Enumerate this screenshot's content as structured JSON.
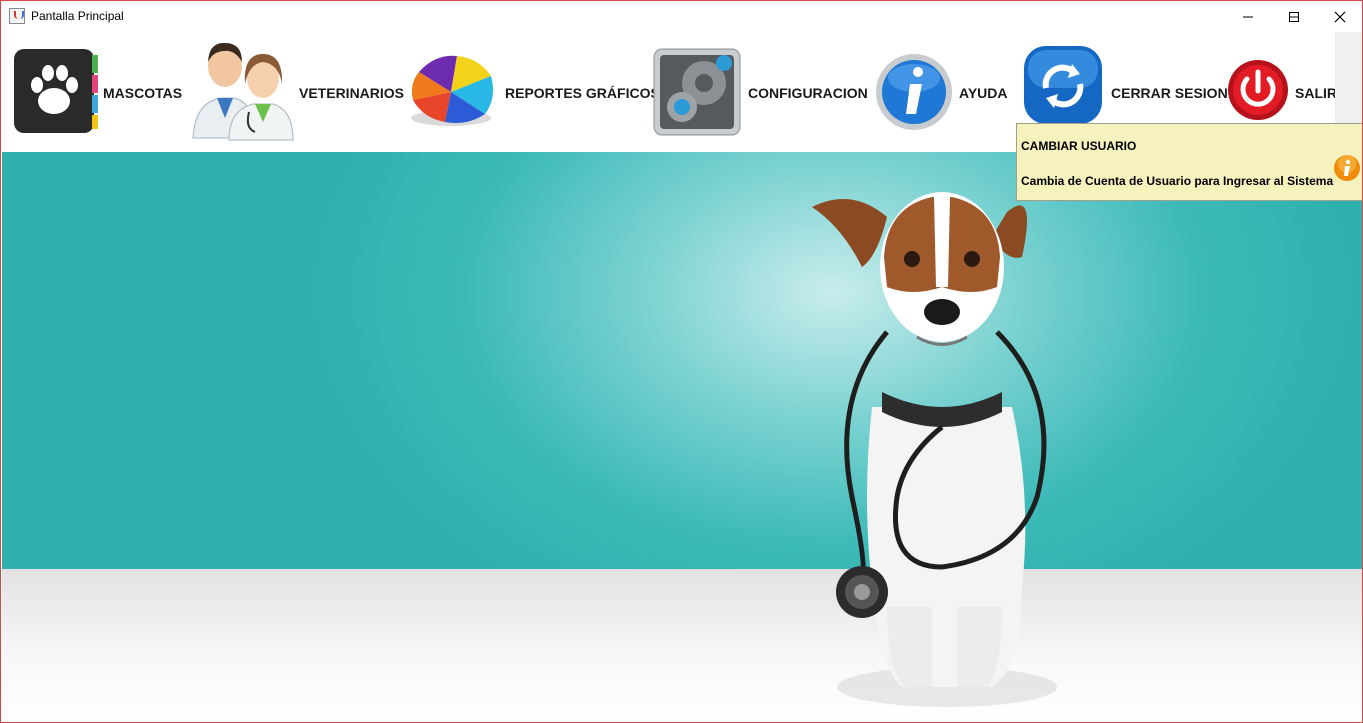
{
  "window": {
    "title": "Pantalla Principal",
    "controls": [
      "minimize",
      "maximize",
      "close"
    ]
  },
  "toolbar": {
    "items": [
      {
        "label": "MASCOTAS",
        "icon": "paw-book-icon"
      },
      {
        "label": "VETERINARIOS",
        "icon": "doctors-icon"
      },
      {
        "label": "REPORTES GRÁFICOS",
        "icon": "pie-chart-icon"
      },
      {
        "label": "CONFIGURACION",
        "icon": "gears-icon"
      },
      {
        "label": "AYUDA",
        "icon": "info-icon"
      },
      {
        "label": "CERRAR SESION",
        "icon": "refresh-icon"
      },
      {
        "label": "SALIR",
        "icon": "power-icon"
      }
    ]
  },
  "tooltip": {
    "title": "CAMBIAR USUARIO",
    "description": "Cambia de Cuenta de Usuario para Ingresar al Sistema",
    "icon": "info-icon"
  },
  "main": {
    "background": "dog-with-stethoscope-banner",
    "colors": {
      "teal": "#2fb1af",
      "floor": "#ececec"
    }
  }
}
